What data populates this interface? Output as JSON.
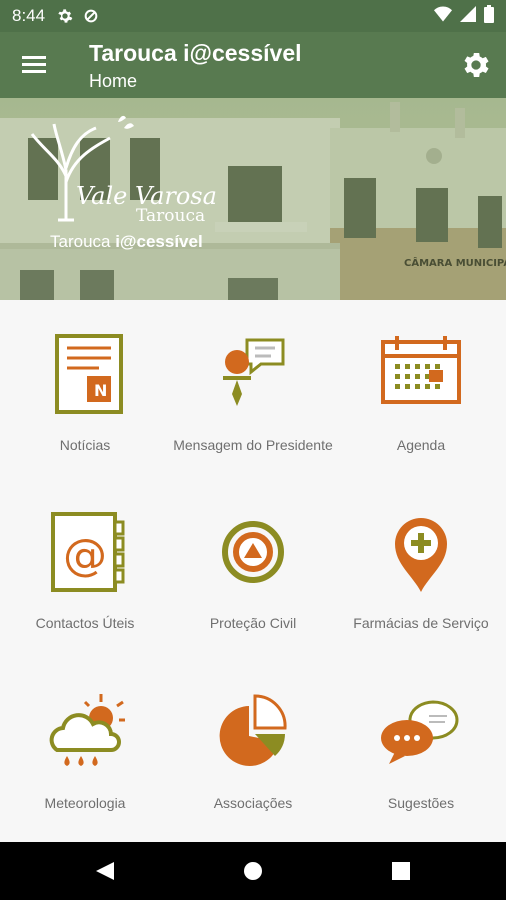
{
  "status_bar": {
    "time": "8:44"
  },
  "app_bar": {
    "title": "Tarouca i@cessível",
    "subtitle": "Home"
  },
  "banner": {
    "logo_line1": "Vale Varosa",
    "logo_line2": "Tarouca",
    "brand_prefix": "Tarouca ",
    "brand_bold": "i@cessível",
    "building_sign": "CÂMARA MUNICIPAL"
  },
  "menu": [
    {
      "label": "Notícias",
      "icon": "newspaper-icon"
    },
    {
      "label": "Mensagem do Presidente",
      "icon": "president-message-icon"
    },
    {
      "label": "Agenda",
      "icon": "calendar-icon"
    },
    {
      "label": "Contactos Úteis",
      "icon": "contacts-book-icon"
    },
    {
      "label": "Proteção Civil",
      "icon": "civil-protection-icon"
    },
    {
      "label": "Farmácias de Serviço",
      "icon": "pharmacy-pin-icon"
    },
    {
      "label": "Meteorologia",
      "icon": "weather-icon"
    },
    {
      "label": "Associações",
      "icon": "pie-chart-icon"
    },
    {
      "label": "Sugestões",
      "icon": "speech-bubbles-icon"
    }
  ],
  "colors": {
    "appbar": "#587a50",
    "statusbar": "#4f7149",
    "orange": "#d2691e",
    "olive": "#8c8c22"
  }
}
